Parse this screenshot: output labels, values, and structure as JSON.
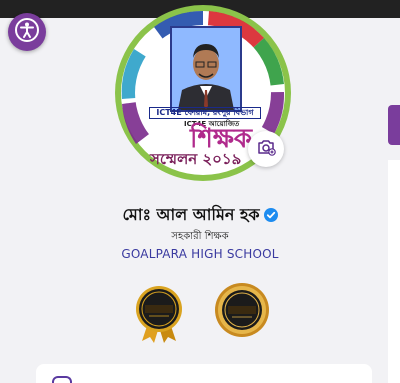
{
  "profile": {
    "name": "মোঃ আল আমিন হক",
    "designation": "সহকারী শিক্ষক",
    "school": "GOALPARA HIGH SCHOOL"
  },
  "banner": {
    "forum": "ICT4E ফোরাম, রংপুর বিভাগ",
    "organizer": "ICT4E আয়োজিত",
    "teacher": "শিক্ষক",
    "conference": "সম্মেলন ২০১৯"
  },
  "colors": {
    "accent": "#7a3d9c",
    "school_text": "#3a3aa0",
    "verified": "#1d8cf0"
  },
  "icons": {
    "accessibility": "accessibility-icon",
    "camera": "camera-icon",
    "verified": "verified-check-icon"
  }
}
